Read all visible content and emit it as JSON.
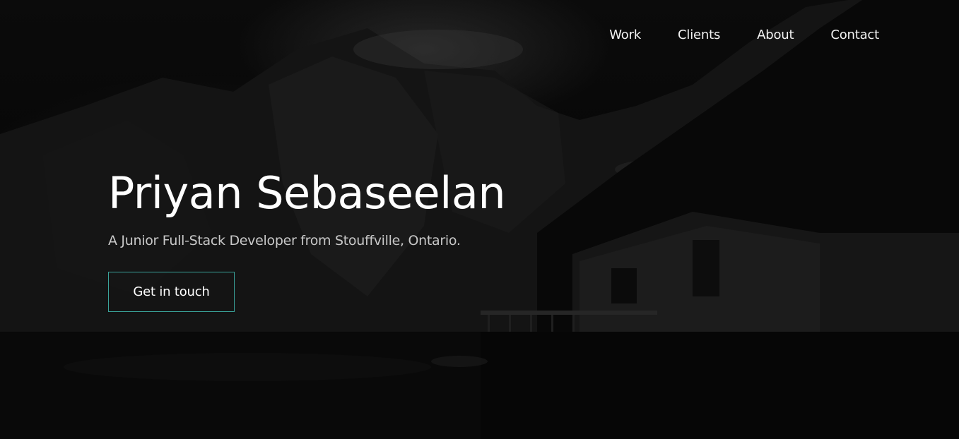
{
  "nav": {
    "items": [
      {
        "label": "Work"
      },
      {
        "label": "Clients"
      },
      {
        "label": "About"
      },
      {
        "label": "Contact"
      }
    ]
  },
  "hero": {
    "title": "Priyan Sebaseelan",
    "subtitle": "A Junior Full-Stack Developer from Stouffville, Ontario.",
    "cta_label": "Get in touch",
    "background_image": "dark mountain lake cabin photo"
  },
  "colors": {
    "background": "#050505",
    "text": "#ffffff",
    "subtitle": "#c8c8c8",
    "button_border": "#3aa39a"
  }
}
